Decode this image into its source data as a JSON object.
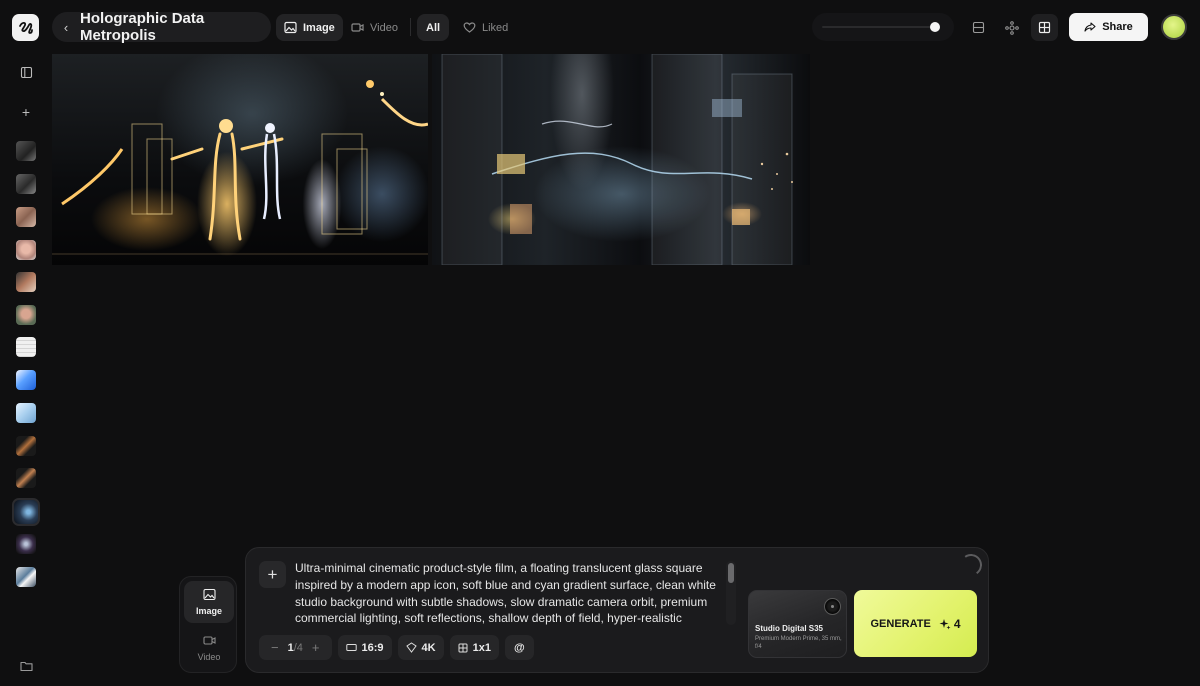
{
  "header": {
    "title": "Holographic Data Metropolis",
    "filters": [
      {
        "label": "Image",
        "icon": "image-icon",
        "active": true
      },
      {
        "label": "Video",
        "icon": "video-icon",
        "active": false
      },
      {
        "label": "All",
        "active": true
      },
      {
        "label": "Liked",
        "icon": "heart-icon",
        "active": false
      }
    ],
    "zoom_level": 0.85,
    "share_label": "Share",
    "view_icons": [
      "panel-layout-icon",
      "nodes-icon",
      "grid-view-icon"
    ]
  },
  "sidebar": {
    "thumbnails_count": 14,
    "selected_index": 11
  },
  "mode_switch": {
    "image_label": "Image",
    "video_label": "Video",
    "active": "Image"
  },
  "prompt": {
    "text": "Ultra-minimal cinematic product-style film, a floating translucent glass square inspired by a modern app icon, soft blue and cyan gradient surface, clean white studio background with subtle shadows, slow dramatic camera orbit, premium commercial lighting, soft reflections, shallow depth of field, hyper-realistic",
    "count_current": "1",
    "count_total": "/4",
    "aspect_ratio": "16:9",
    "resolution": "4K",
    "grid": "1x1",
    "mention": "@"
  },
  "model": {
    "name": "Studio Digital S35",
    "description": "Premium Modern Prime, 35 mm, f/4"
  },
  "generate": {
    "label": "GENERATE",
    "cost": "4"
  },
  "colors": {
    "background": "#0f0f10",
    "accent": "#e2f26b"
  }
}
